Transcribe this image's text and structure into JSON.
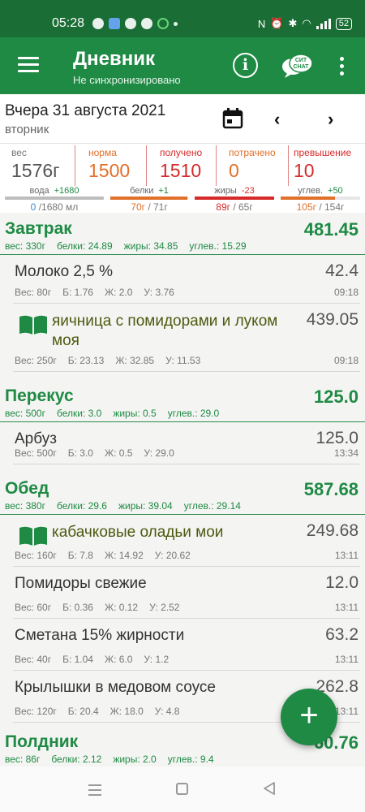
{
  "status": {
    "time": "05:28",
    "battery": "52"
  },
  "appbar": {
    "title": "Дневник",
    "subtitle": "Не синхронизировано",
    "chat_icon_text": "СИТ CHAT"
  },
  "date": {
    "title": "Вчера 31 августа 2021",
    "weekday": "вторник"
  },
  "summary": {
    "weight_label": "вес",
    "weight_value": "1576г",
    "norm_label": "норма",
    "norm_value": "1500",
    "received_label": "получено",
    "received_value": "1510",
    "spent_label": "потрачено",
    "spent_value": "0",
    "excess_label": "превышение",
    "excess_value": "10",
    "colors": {
      "gray": "#777777",
      "orange": "#e0702a",
      "red": "#d62a2a"
    }
  },
  "macros": [
    {
      "label": "вода",
      "delta": "+1680",
      "value_cur": "0",
      "value_rest": " /1680 мл",
      "fill": 0.0,
      "bar_color": "#bdbdbd",
      "cur_color": "#3a8ad6",
      "delta_color": "#1e8a44"
    },
    {
      "label": "белки",
      "delta": "+1",
      "value_cur": "70г",
      "value_rest": " / 71г",
      "fill": 0.99,
      "bar_color": "#e0702a",
      "cur_color": "#e0702a",
      "delta_color": "#1e8a44"
    },
    {
      "label": "жиры",
      "delta": "-23",
      "value_cur": "89г",
      "value_rest": " / 65г",
      "fill": 1.0,
      "bar_color": "#d62a2a",
      "cur_color": "#d62a2a",
      "delta_color": "#d62a2a"
    },
    {
      "label": "углев.",
      "delta": "+50",
      "value_cur": "105г",
      "value_rest": " / 154г",
      "fill": 0.68,
      "bar_color": "#e0702a",
      "cur_color": "#e0702a",
      "delta_color": "#1e8a44"
    }
  ],
  "meals": [
    {
      "name": "Завтрак",
      "total": "481.45",
      "weight": "вес: 330г",
      "protein": "белки: 24.89",
      "fat": "жиры: 34.85",
      "carbs": "углев.: 15.29"
    },
    {
      "name": "Перекус",
      "total": "125.0",
      "weight": "вес: 500г",
      "protein": "белки: 3.0",
      "fat": "жиры: 0.5",
      "carbs": "углев.: 29.0"
    },
    {
      "name": "Обед",
      "total": "587.68",
      "weight": "вес: 380г",
      "protein": "белки: 29.6",
      "fat": "жиры: 39.04",
      "carbs": "углев.: 29.14"
    },
    {
      "name": "Полдник",
      "total": "60.76",
      "weight": "вес: 86г",
      "protein": "белки: 2.12",
      "fat": "жиры: 2.0",
      "carbs": "углев.: 9.4"
    }
  ],
  "foods": [
    {
      "name": "Молоко 2,5 %",
      "total": "42.4",
      "weight": "Вес: 80г",
      "p": "Б: 1.76",
      "f": "Ж: 2.0",
      "c": "У: 3.76",
      "time": "09:18",
      "recipe": false
    },
    {
      "name": "яичница с помидорами и луком моя",
      "total": "439.05",
      "weight": "Вес: 250г",
      "p": "Б: 23.13",
      "f": "Ж: 32.85",
      "c": "У: 11.53",
      "time": "09:18",
      "recipe": true
    },
    {
      "name": "Арбуз",
      "total": "125.0",
      "weight": "Вес: 500г",
      "p": "Б: 3.0",
      "f": "Ж: 0.5",
      "c": "У: 29.0",
      "time": "13:34",
      "recipe": false
    },
    {
      "name": "кабачковые оладьи мои",
      "total": "249.68",
      "weight": "Вес: 160г",
      "p": "Б: 7.8",
      "f": "Ж: 14.92",
      "c": "У: 20.62",
      "time": "13:11",
      "recipe": true
    },
    {
      "name": "Помидоры свежие",
      "total": "12.0",
      "weight": "Вес: 60г",
      "p": "Б: 0.36",
      "f": "Ж: 0.12",
      "c": "У: 2.52",
      "time": "13:11",
      "recipe": false
    },
    {
      "name": "Сметана 15% жирности",
      "total": "63.2",
      "weight": "Вес: 40г",
      "p": "Б: 1.04",
      "f": "Ж: 6.0",
      "c": "У: 1.2",
      "time": "13:11",
      "recipe": false
    },
    {
      "name": "Крылышки в медовом соусе",
      "total": "262.8",
      "weight": "Вес: 120г",
      "p": "Б: 20.4",
      "f": "Ж: 18.0",
      "c": "У: 4.8",
      "time": "13:11",
      "recipe": false
    }
  ],
  "fab": {
    "label": "+"
  }
}
